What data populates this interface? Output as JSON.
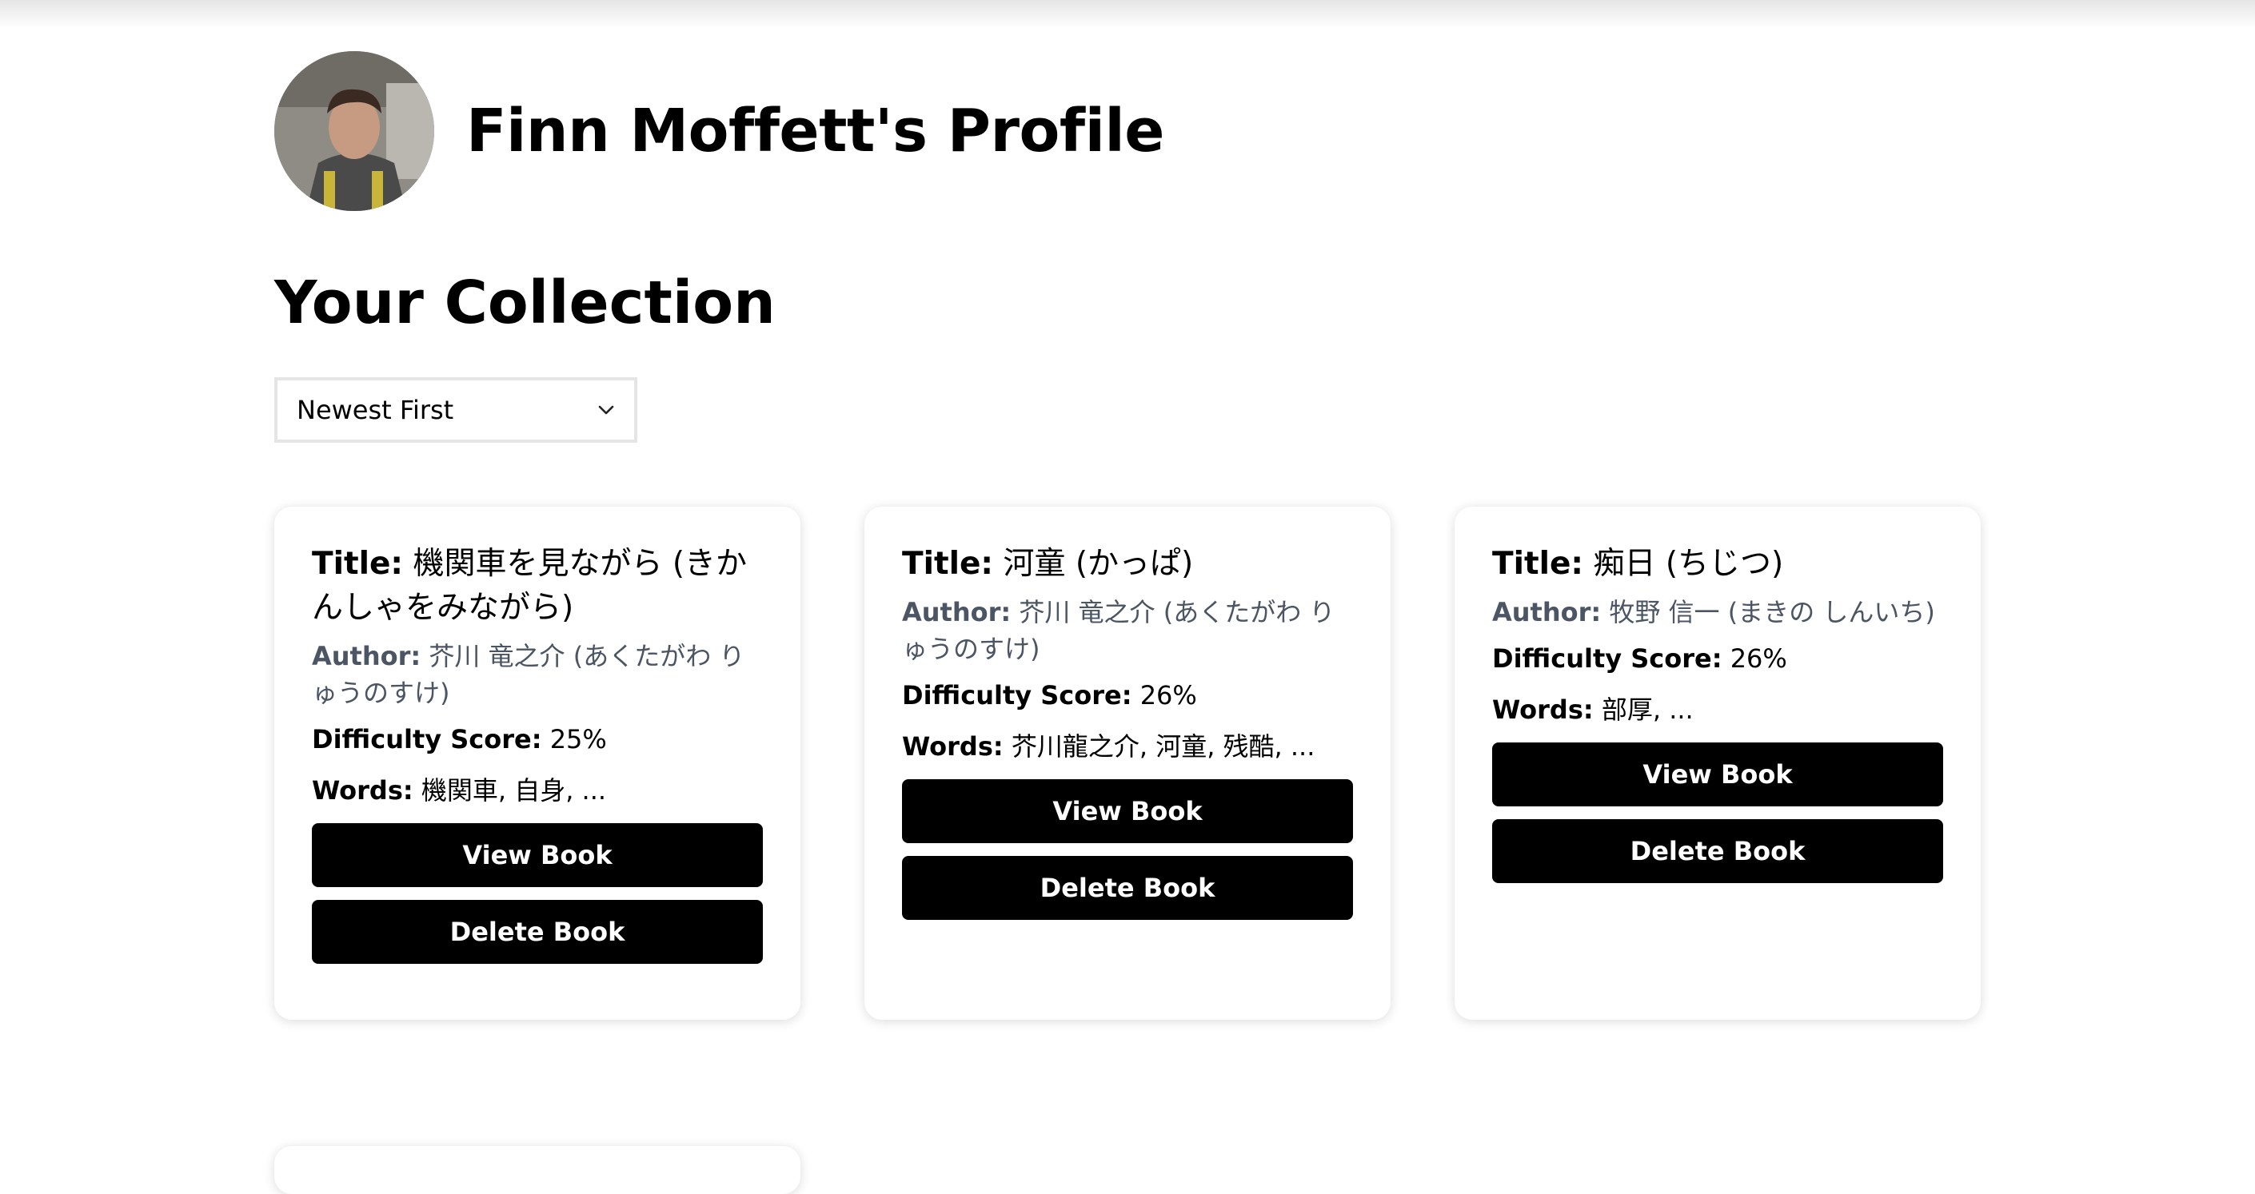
{
  "profile": {
    "name_title": "Finn Moffett's Profile",
    "avatar_icon": "user-photo"
  },
  "collection": {
    "heading": "Your Collection",
    "sort": {
      "selected": "Newest First"
    },
    "labels": {
      "title": "Title:",
      "author": "Author:",
      "difficulty": "Difficulty Score:",
      "words": "Words:",
      "view_button": "View Book",
      "delete_button": "Delete Book"
    },
    "books": [
      {
        "title": "機関車を見ながら (きかんしゃをみながら)",
        "author": "芥川 竜之介 (あくたがわ りゅうのすけ)",
        "difficulty": "25%",
        "words": "機関車, 自身, ..."
      },
      {
        "title": "河童 (かっぱ)",
        "author": "芥川 竜之介 (あくたがわ りゅうのすけ)",
        "difficulty": "26%",
        "words": "芥川龍之介, 河童, 残酷, ..."
      },
      {
        "title": "痴日 (ちじつ)",
        "author": "牧野 信一 (まきの しんいち)",
        "difficulty": "26%",
        "words": "部厚, ..."
      }
    ]
  },
  "colors": {
    "button_bg": "#000000",
    "button_text": "#ffffff",
    "author_text": "#4b5563",
    "page_bg": "#ffffff"
  }
}
